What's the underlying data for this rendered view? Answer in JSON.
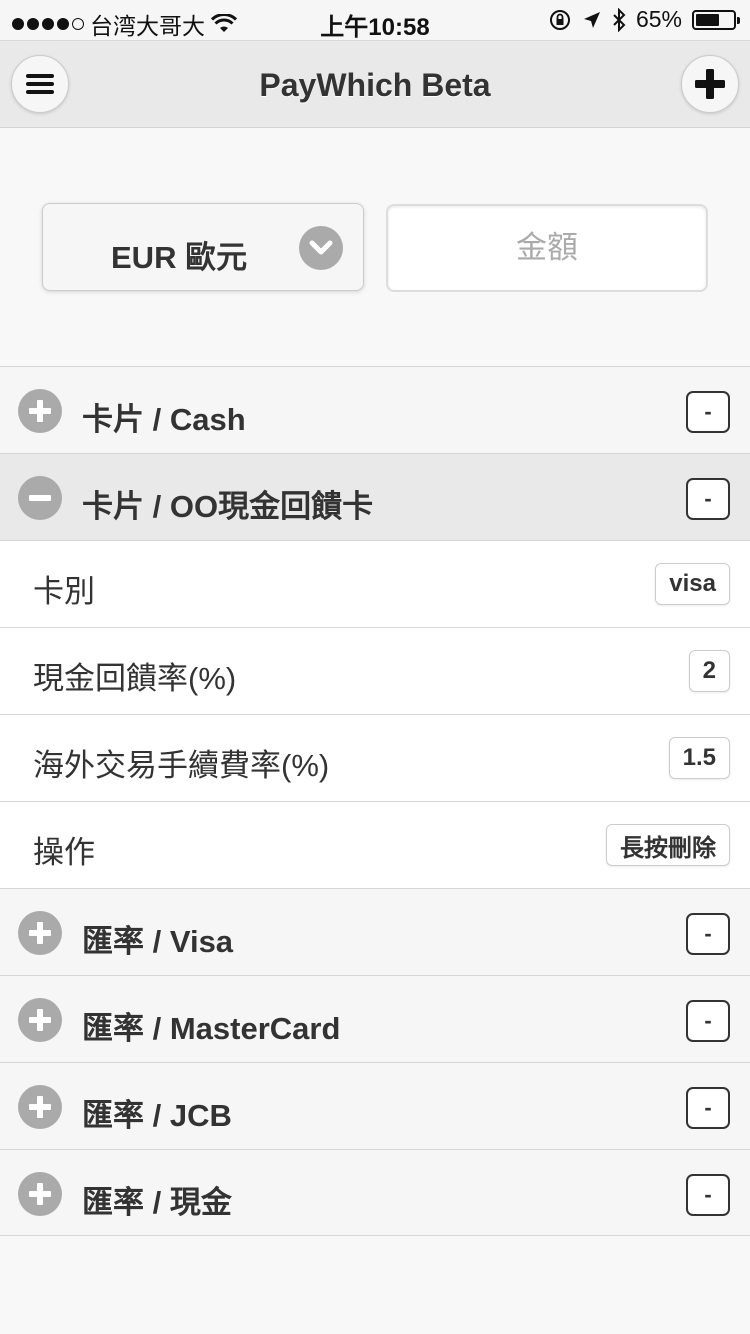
{
  "status_bar": {
    "carrier": "台湾大哥大",
    "time": "上午10:58",
    "battery": "65%",
    "battery_level": 0.65,
    "signal_bars_filled": 4,
    "signal_bars_total": 5
  },
  "header": {
    "title": "PayWhich Beta",
    "menu_icon": "hamburger-menu-icon",
    "add_icon": "plus-icon"
  },
  "form": {
    "currency": "EUR 歐元",
    "amount_placeholder": "金額",
    "amount_value": ""
  },
  "sections": [
    {
      "title": "卡片 / Cash",
      "state": "collapsed",
      "count": "-"
    },
    {
      "title": "卡片 / OO現金回饋卡",
      "state": "expanded",
      "count": "-"
    }
  ],
  "card_details": [
    {
      "label": "卡別",
      "value": "visa"
    },
    {
      "label": "現金回饋率(%)",
      "value": "2"
    },
    {
      "label": "海外交易手續費率(%)",
      "value": "1.5"
    },
    {
      "label": "操作",
      "value": "長按刪除"
    }
  ],
  "rate_sections": [
    {
      "title": "匯率 / Visa",
      "count": "-"
    },
    {
      "title": "匯率 / MasterCard",
      "count": "-"
    },
    {
      "title": "匯率 / JCB",
      "count": "-"
    },
    {
      "title": "匯率 / 現金",
      "count": "-"
    }
  ],
  "colors": {
    "header_bg": "#e9e9e9",
    "icon_grey": "#aaaaaa",
    "text": "#333333"
  }
}
